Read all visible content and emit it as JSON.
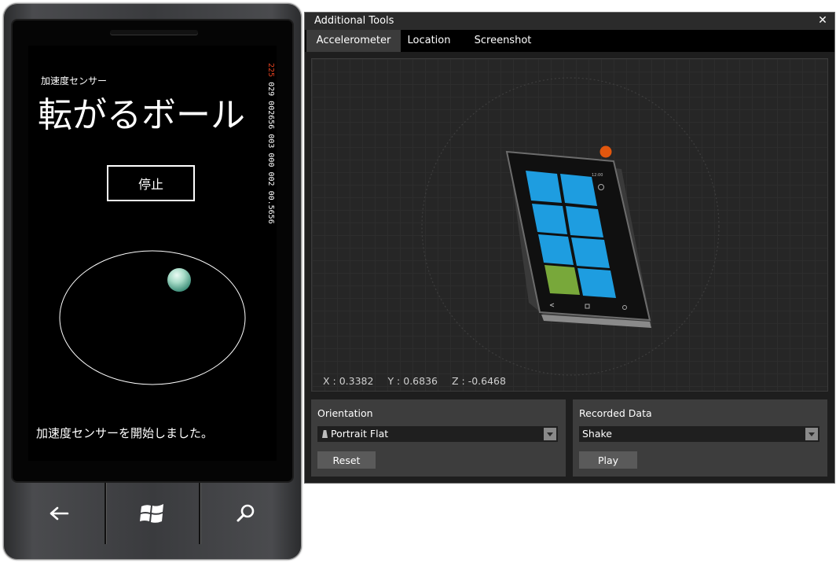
{
  "phone": {
    "app_caption": "加速度センサー",
    "app_title": "転がるボール",
    "stop_button": "停止",
    "status_message": "加速度センサーを開始しました。",
    "perf_counter": {
      "hot": "225",
      "rest": "029 002656 003 000 002 00.5656"
    },
    "hw_buttons": {
      "back": "←",
      "start": "⊞",
      "search": "⌕"
    }
  },
  "tools": {
    "title": "Additional Tools",
    "close": "✕",
    "tabs": [
      {
        "label": "Accelerometer",
        "active": true
      },
      {
        "label": "Location",
        "active": false
      },
      {
        "label": "Screenshot",
        "active": false
      }
    ],
    "readout": {
      "x": "X : 0.3382",
      "y": "Y : 0.6836",
      "z": "Z : -0.6468"
    },
    "orientation": {
      "title": "Orientation",
      "selected": "Portrait Flat",
      "button": "Reset"
    },
    "recorded": {
      "title": "Recorded Data",
      "selected": "Shake",
      "button": "Play"
    }
  },
  "colors": {
    "tile_blue": "#1e9de0",
    "tile_green": "#78a83a",
    "handle_orange": "#e2570e",
    "perf_hot": "#e0401f"
  },
  "icons": [
    "back-arrow-icon",
    "windows-logo-icon",
    "search-icon",
    "close-icon",
    "chevron-down-icon",
    "phone-orientation-icon"
  ]
}
